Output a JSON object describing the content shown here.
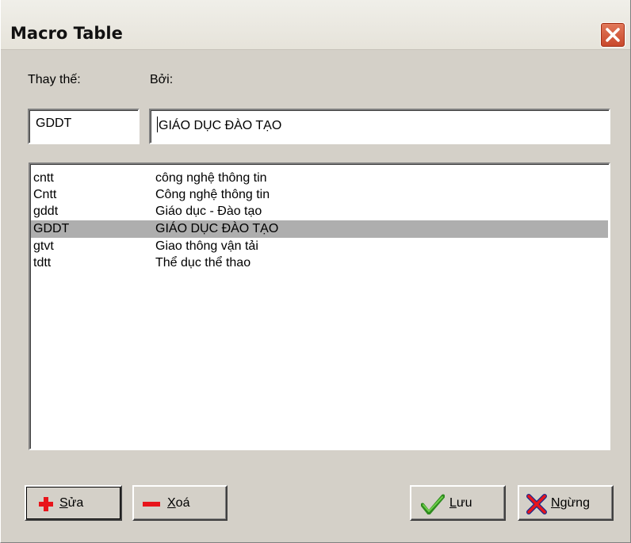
{
  "window": {
    "title": "Macro Table"
  },
  "labels": {
    "replace": "Thay thế:",
    "with": "Bởi:"
  },
  "inputs": {
    "replace_value": "GDDT",
    "with_value": "GIÁO DỤC ĐÀO TẠO"
  },
  "macros": [
    {
      "key": "cntt",
      "value": "công nghệ thông tin",
      "selected": false
    },
    {
      "key": "Cntt",
      "value": "Công nghệ thông tin",
      "selected": false
    },
    {
      "key": "gddt",
      "value": "Giáo dục - Đào tạo",
      "selected": false
    },
    {
      "key": "GDDT",
      "value": "GIÁO DỤC ĐÀO TẠO",
      "selected": true
    },
    {
      "key": "gtvt",
      "value": "Giao thông vận tải",
      "selected": false
    },
    {
      "key": "tdtt",
      "value": "Thể dục thể thao",
      "selected": false
    }
  ],
  "buttons": {
    "edit": {
      "mnemonic": "S",
      "rest": "ửa",
      "icon": "plus-icon"
    },
    "delete": {
      "mnemonic": "X",
      "rest": "oá",
      "icon": "minus-icon"
    },
    "save": {
      "mnemonic": "L",
      "rest": "ưu",
      "icon": "checkmark-icon"
    },
    "stop": {
      "mnemonic": "N",
      "rest": "gừng",
      "icon": "x-mark-icon"
    }
  },
  "colors": {
    "dialog_bg": "#d4d0c8",
    "selection": "#aeaeae",
    "close_red": "#c8472a"
  }
}
